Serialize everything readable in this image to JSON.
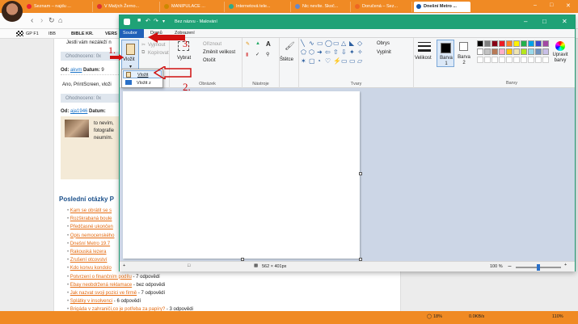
{
  "browser": {
    "tabs": [
      {
        "label": "Seznam – najdu ..."
      },
      {
        "label": "V Malých Žerno..."
      },
      {
        "label": "MANIPULACE ..."
      },
      {
        "label": "Internetová tele..."
      },
      {
        "label": "Nic nevíte. Skoč..."
      },
      {
        "label": "Doručená – Sez..."
      },
      {
        "label": "Dnešní Metro ..."
      }
    ],
    "bookmarks": [
      "GP F1",
      "IBB",
      "BIBLE KR.",
      "VERS"
    ],
    "status": {
      "zoom": "110%",
      "speed": "0.0KB/s",
      "cpu": "18%"
    }
  },
  "webpage": {
    "intro_line": "Jestli vám nezáleží n",
    "rows": [
      {
        "type": "rating",
        "text": "Ohodnoceno: 0x"
      },
      {
        "type": "author",
        "label": "Od:",
        "author": "akvm",
        "date_label": "Datum:",
        "date": "9"
      },
      {
        "type": "text",
        "text": "Ano, PrintScreen, vloži"
      },
      {
        "type": "rating",
        "text": "Ohodnoceno: 0x"
      },
      {
        "type": "author",
        "label": "Od:",
        "author": "aja1946",
        "date_label": "Datum:",
        "date": ""
      },
      {
        "type": "text",
        "text": "to nevím,"
      },
      {
        "type": "text",
        "text": "fotografie"
      },
      {
        "type": "text",
        "text": "neumím."
      }
    ],
    "section_title": "Poslední otázky P",
    "questions": [
      {
        "link": "Kam se obrátit se s",
        "suffix": ""
      },
      {
        "link": "Rozškrabaná boule",
        "suffix": ""
      },
      {
        "link": "Předčasné ukončen",
        "suffix": ""
      },
      {
        "link": "Opis nemocenského",
        "suffix": ""
      },
      {
        "link": "Dnešní Metro 19.7",
        "suffix": ""
      },
      {
        "link": "Rakouská lezera",
        "suffix": ""
      },
      {
        "link": "Zrušení otcovství",
        "suffix": ""
      },
      {
        "link": "Kdo konvu kondolo",
        "suffix": ""
      },
      {
        "link": "Potvrzení o finančním podílu",
        "suffix": " - 7 odpovědí"
      },
      {
        "link": "Ebay neobdržená reklamace",
        "suffix": " - bez odpovědi"
      },
      {
        "link": "Jak nazvat svoji pozici ve firmě",
        "suffix": " - 7 odpovědí"
      },
      {
        "link": "Splátky v insolvenci",
        "suffix": " - 6 odpovědí"
      },
      {
        "link": "Brigáda v zahraničí,co je potřeba za papíry?",
        "suffix": " - 3 odpovědi"
      }
    ]
  },
  "paint": {
    "title": "Bez názvu - Malování",
    "tabs": [
      "Soubor",
      "Domů",
      "Zobrazení"
    ],
    "clipboard": {
      "paste": "Vložit",
      "cut": "Vyjmout",
      "copy": "Kopírovat"
    },
    "image": {
      "select": "Vybrat",
      "crop": "Oříznout",
      "resize": "Změnit velikost",
      "rotate": "Otočit",
      "label": "Obrázek"
    },
    "tools_label": "Nástroje",
    "brushes": "Štětce",
    "shapes": {
      "outline": "Obrys",
      "fill": "Vyplnit",
      "label": "Tvary"
    },
    "size": "Velikost",
    "color1": "Barva 1",
    "color2": "Barva 2",
    "edit_colors": "Upravit barvy",
    "colors_label": "Barvy",
    "dropdown": {
      "paste": "Vložit",
      "paste_from": "Vložit z"
    },
    "status": {
      "dimensions": "562 × 401px",
      "zoom": "100 %"
    },
    "palette": [
      "#000000",
      "#7f7f7f",
      "#880015",
      "#ed1c24",
      "#ff7f27",
      "#fff200",
      "#22b14c",
      "#00a2e8",
      "#3f48cc",
      "#a349a4",
      "#ffffff",
      "#c3c3c3",
      "#b97a57",
      "#ffaec9",
      "#ffc90e",
      "#efe4b0",
      "#b5e61d",
      "#99d9ea",
      "#7092be",
      "#c8bfe7"
    ]
  },
  "annotations": {
    "one": "1.",
    "two": "2.",
    "three": "3."
  }
}
